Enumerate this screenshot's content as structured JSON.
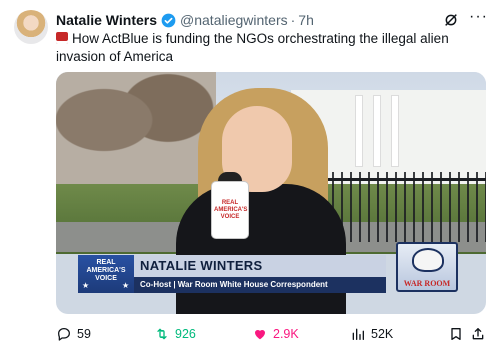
{
  "tweet": {
    "author_name": "Natalie Winters",
    "handle": "@nataliegwinters",
    "separator": "·",
    "time": "7h",
    "text": "How ActBlue is funding the NGOs orchestrating the illegal alien invasion of America"
  },
  "media": {
    "lower_third": {
      "logo_line1": "REAL",
      "logo_line2": "AMERICA'S",
      "logo_line3": "VOICE",
      "name": "NATALIE WINTERS",
      "title": "Co-Host | War Room White House Correspondent"
    },
    "mic_flag_line1": "REAL",
    "mic_flag_line2": "AMERICA'S",
    "mic_flag_line3": "VOICE",
    "bug_text": "WAR ROOM"
  },
  "actions": {
    "replies": "59",
    "reposts": "926",
    "likes": "2.9K",
    "views": "52K"
  },
  "icons": [
    "verified-badge-icon",
    "grok-icon",
    "more-icon",
    "book-emoji-icon",
    "reply-icon",
    "repost-icon",
    "like-icon",
    "views-icon",
    "bookmark-icon",
    "share-icon"
  ],
  "colors": {
    "verified": "#1d9bf0",
    "repost": "#00ba7c",
    "like": "#f91880",
    "muted": "#536471"
  }
}
